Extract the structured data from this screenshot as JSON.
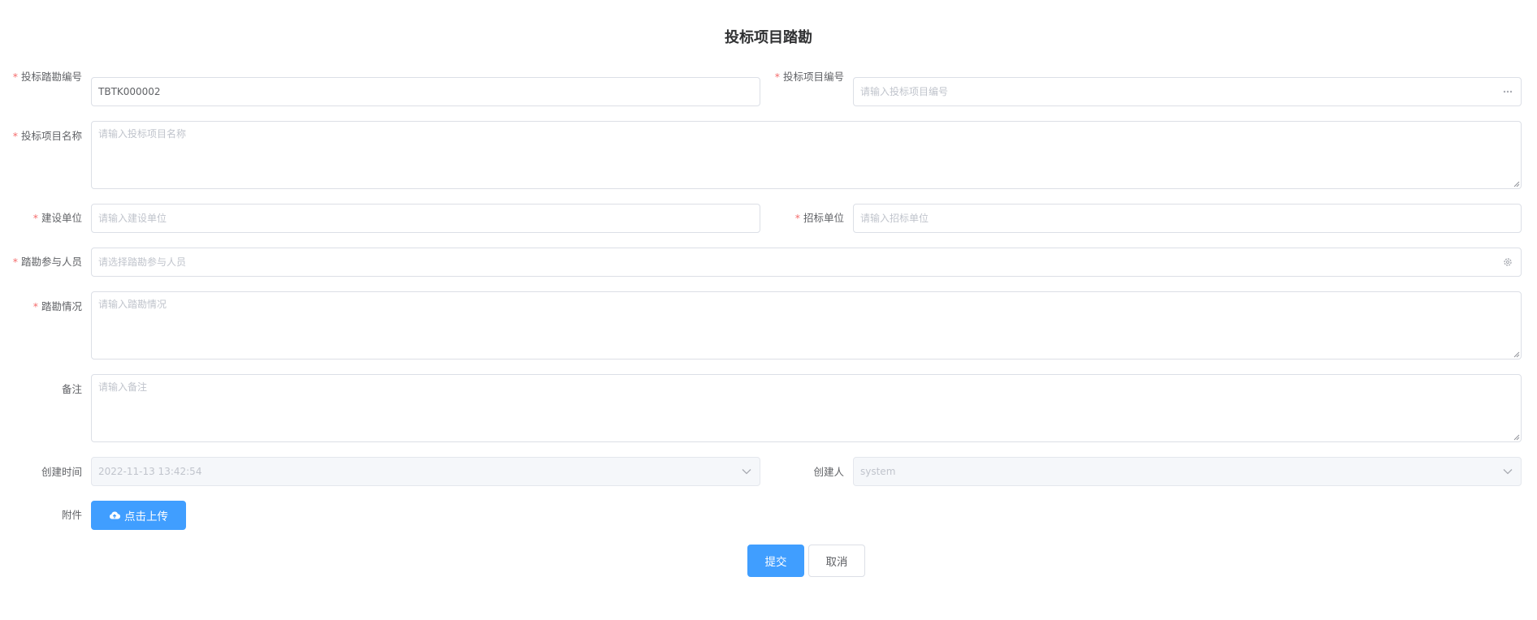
{
  "page": {
    "title": "投标项目踏勘"
  },
  "form": {
    "survey_no": {
      "label": "投标踏勘编号",
      "value": "TBTK000002"
    },
    "project_no": {
      "label": "投标项目编号",
      "placeholder": "请输入投标项目编号"
    },
    "project_name": {
      "label": "投标项目名称",
      "placeholder": "请输入投标项目名称"
    },
    "construction_unit": {
      "label": "建设单位",
      "placeholder": "请输入建设单位"
    },
    "tender_unit": {
      "label": "招标单位",
      "placeholder": "请输入招标单位"
    },
    "participants": {
      "label": "踏勘参与人员",
      "placeholder": "请选择踏勘参与人员"
    },
    "survey_status": {
      "label": "踏勘情况",
      "placeholder": "请输入踏勘情况"
    },
    "remark": {
      "label": "备注",
      "placeholder": "请输入备注"
    },
    "created_time": {
      "label": "创建时间",
      "value": "2022-11-13 13:42:54"
    },
    "creator": {
      "label": "创建人",
      "value": "system"
    },
    "attachment": {
      "label": "附件",
      "upload_label": "点击上传"
    },
    "required_mark": "*"
  },
  "actions": {
    "submit": "提交",
    "cancel": "取消"
  },
  "icons": {
    "more": "more-dots-icon",
    "select_person": "gear-icon",
    "dropdown": "chevron-down-icon",
    "upload": "cloud-upload-icon"
  },
  "colors": {
    "primary": "#409eff",
    "required": "#f56c6c",
    "border": "#dcdfe6",
    "disabled_bg": "#f5f7fa"
  }
}
